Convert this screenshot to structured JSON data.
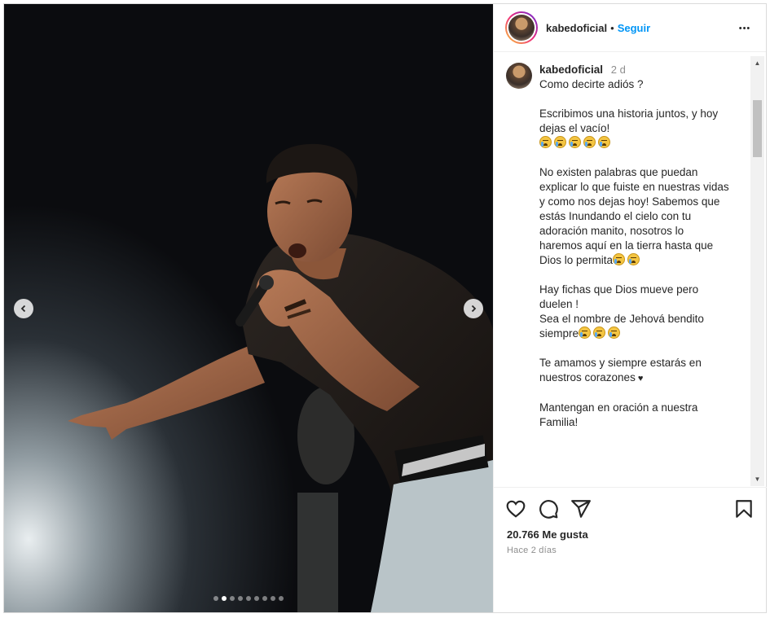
{
  "post": {
    "username": "kabedoficial",
    "separator": "•",
    "follow_label": "Seguir",
    "more_label": "•••",
    "carousel": {
      "total_slides": 9,
      "current_slide": 2
    }
  },
  "caption": {
    "username": "kabedoficial",
    "time": "2 d",
    "lines": [
      "Como decirte adiós ?",
      "",
      "Escribimos una historia juntos, y hoy",
      "dejas el vacío!",
      "",
      "No existen palabras que puedan",
      "explicar lo que fuiste en nuestras vidas",
      "y como nos dejas hoy! Sabemos que",
      "estás Inundando el cielo con tu",
      "adoración manito, nosotros lo",
      "haremos aquí en la tierra hasta que",
      "Dios lo permita",
      "",
      "Hay fichas que Dios mueve pero",
      "duelen !",
      "Sea el nombre de Jehová bendito",
      "siempre",
      "",
      "Te amamos y siempre estarás en",
      "nuestros corazones",
      "",
      "Mantengan en oración a nuestra",
      "Familia!"
    ],
    "heart_glyph": "♥"
  },
  "engagement": {
    "likes": "20.766 Me gusta",
    "posted": "Hace 2 días"
  },
  "icons": [
    "heart-icon",
    "comment-icon",
    "share-icon",
    "bookmark-icon",
    "chevron-left-icon",
    "chevron-right-icon",
    "more-icon"
  ],
  "colors": {
    "link": "#0095f6",
    "muted": "#8e8e8e",
    "text": "#262626",
    "border": "#dbdbdb"
  }
}
